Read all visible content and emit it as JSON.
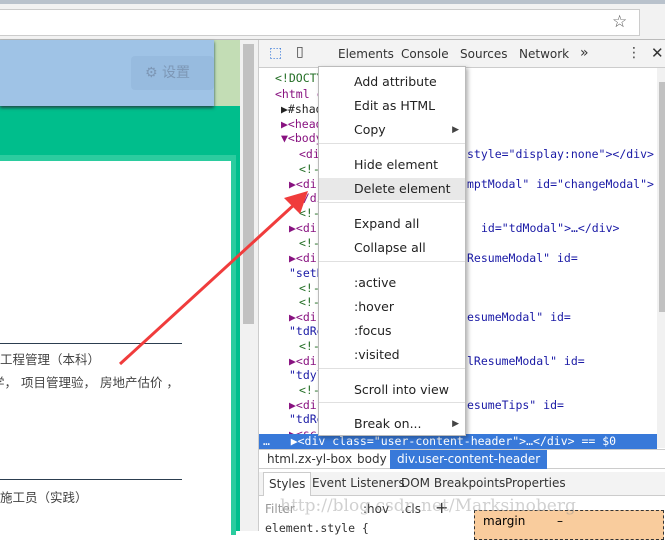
{
  "browser": {
    "star_icon": "star-icon"
  },
  "page": {
    "settings_label": "设置",
    "line1": "工程管理（本科）",
    "line2": "学， 项目管理验， 房地产估价 ，",
    "line3": "施工员（实践）"
  },
  "devtools": {
    "tabs": [
      "Elements",
      "Console",
      "Sources",
      "Network"
    ],
    "more": "»",
    "code_lines": [
      [
        "<!DOCTY",
        "",
        ""
      ],
      [
        "<html c",
        "",
        ""
      ],
      [
        "#shad",
        "",
        ""
      ],
      [
        "<head",
        "",
        ""
      ],
      [
        "<body",
        "",
        ""
      ],
      [
        "<di",
        "style=\"display:none\"></div>",
        ""
      ],
      [
        "<!-",
        "",
        ""
      ],
      [
        "<di",
        "mptModal\" id=\"changeModal\">",
        ""
      ],
      [
        "…</di",
        "",
        ""
      ],
      [
        "<!-",
        "",
        ""
      ],
      [
        "<di",
        "id=\"tdModal\">…</div>",
        ""
      ],
      [
        "<!-",
        "",
        ""
      ],
      [
        "<di",
        "ResumeModal\" id=",
        ""
      ],
      [
        "\"setR",
        "",
        ""
      ],
      [
        "<!-",
        "",
        ""
      ],
      [
        "<!-",
        "",
        ""
      ],
      [
        "<di",
        "esumeModal\" id=",
        ""
      ],
      [
        "\"tdRe",
        "",
        ""
      ],
      [
        "<!-",
        "",
        ""
      ],
      [
        "<di",
        "lResumeModal\" id=",
        ""
      ],
      [
        "\"tdyl",
        "",
        ""
      ],
      [
        "<!-",
        "",
        ""
      ],
      [
        "<di",
        "esumeTips\" id=",
        ""
      ],
      [
        "\"tdRe",
        "",
        ""
      ],
      [
        "<sc",
        "",
        ""
      ]
    ],
    "selected_line": "<div class=\"user-content-header\">…</div> == $0",
    "breadcrumbs": [
      "html.zx-yl-box",
      "body",
      "div.user-content-header"
    ],
    "styles_tabs": [
      "Styles",
      "Event Listeners",
      "DOM Breakpoints",
      "Properties"
    ],
    "filter_placeholder": "Filter",
    "hov": ":hov",
    "cls": ".cls",
    "plus": "+",
    "element_style": "element.style {",
    "box_margin": "margin",
    "box_dash": "–"
  },
  "context_menu": {
    "items": [
      "Add attribute",
      "Edit as HTML",
      "Copy",
      "Hide element",
      "Delete element",
      "Expand all",
      "Collapse all",
      ":active",
      ":hover",
      ":focus",
      ":visited",
      "Scroll into view",
      "Break on..."
    ],
    "highlighted": "Delete element"
  },
  "watermark": "http://blog.csdn.net/Marksinoberg",
  "colors": {
    "accent": "#3879d9",
    "arrow": "#f03c3c",
    "page_green": "#00be8c"
  }
}
